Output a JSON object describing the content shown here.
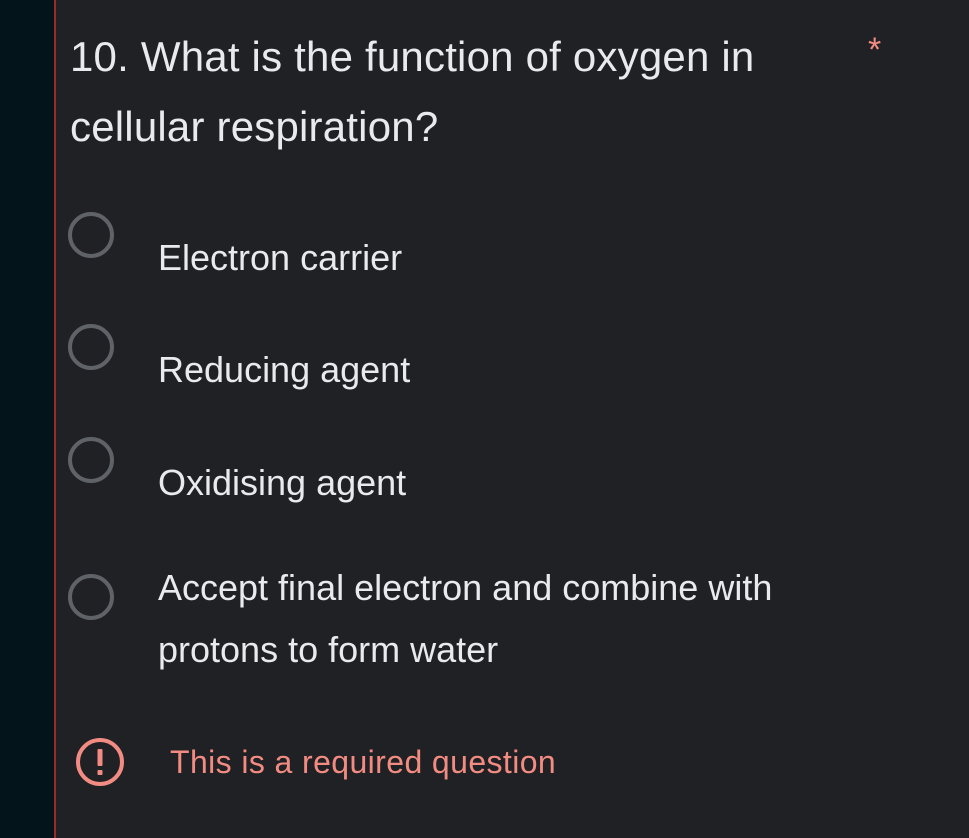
{
  "question": {
    "title": "10. What is the function of oxygen in cellular respiration?",
    "required_marker": "*"
  },
  "options": [
    {
      "label": "Electron carrier",
      "selected": false
    },
    {
      "label": "Reducing agent",
      "selected": false
    },
    {
      "label": "Oxidising agent",
      "selected": false
    },
    {
      "label": "Accept final electron and combine with protons to form water",
      "selected": false
    }
  ],
  "validation": {
    "icon": "error-exclamation-icon",
    "message": "This is a required question",
    "color": "#f28b82"
  },
  "colors": {
    "background": "#202124",
    "text": "#e8eaed",
    "radio_border": "#5f6368",
    "error": "#f28b82",
    "error_bar": "#9c2b23"
  }
}
